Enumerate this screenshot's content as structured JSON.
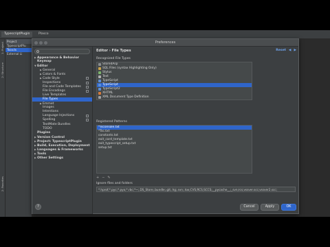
{
  "ide": {
    "project_tab": "TypescriptPlugin",
    "file_tab": "Plasco",
    "project_header": "Project",
    "project_rows": [
      "TypescriptPlu",
      "Tsco.ts",
      "External Li"
    ],
    "left_rail": [
      "1: Project",
      "2: Structure"
    ],
    "left_rail_bottom": "2: Favorites"
  },
  "dialog": {
    "title": "Preferences",
    "tree": [
      {
        "label": "Appearance & Behavior",
        "depth": 0,
        "bold": true,
        "arrow": "▶"
      },
      {
        "label": "Keymap",
        "depth": 0,
        "bold": true
      },
      {
        "label": "Editor",
        "depth": 0,
        "bold": true,
        "arrow": "▼"
      },
      {
        "label": "General",
        "depth": 1,
        "arrow": "▶"
      },
      {
        "label": "Colors & Fonts",
        "depth": 1,
        "arrow": "▶"
      },
      {
        "label": "Code Style",
        "depth": 1,
        "arrow": "▶",
        "proj": true
      },
      {
        "label": "Inspections",
        "depth": 1,
        "proj": true
      },
      {
        "label": "File and Code Templates",
        "depth": 1,
        "proj": true
      },
      {
        "label": "File Encodings",
        "depth": 1,
        "proj": true
      },
      {
        "label": "Live Templates",
        "depth": 1
      },
      {
        "label": "File Types",
        "depth": 1,
        "selected": true
      },
      {
        "label": "Emmet",
        "depth": 1,
        "arrow": "▶"
      },
      {
        "label": "Images",
        "depth": 1
      },
      {
        "label": "Intentions",
        "depth": 1
      },
      {
        "label": "Language Injections",
        "depth": 1,
        "proj": true
      },
      {
        "label": "Spelling",
        "depth": 1,
        "proj": true
      },
      {
        "label": "TextMate Bundles",
        "depth": 1
      },
      {
        "label": "TODO",
        "depth": 1
      },
      {
        "label": "Plugins",
        "depth": 0,
        "bold": true
      },
      {
        "label": "Version Control",
        "depth": 0,
        "bold": true,
        "arrow": "▶"
      },
      {
        "label": "Project: TypescriptPlugin",
        "depth": 0,
        "bold": true,
        "arrow": "▶"
      },
      {
        "label": "Build, Execution, Deployment",
        "depth": 0,
        "bold": true,
        "arrow": "▶"
      },
      {
        "label": "Languages & Frameworks",
        "depth": 0,
        "bold": true,
        "arrow": "▶"
      },
      {
        "label": "Tools",
        "depth": 0,
        "bold": true,
        "arrow": "▶"
      },
      {
        "label": "Other Settings",
        "depth": 0,
        "bold": true,
        "arrow": "▶"
      }
    ],
    "breadcrumb": "Editor › File Types",
    "reset_label": "Reset",
    "nav_back": "◀",
    "nav_forward": "▶",
    "recognized_label": "Recognized File Types",
    "file_types": [
      {
        "label": "StoredAsp",
        "color": "#8a8d90"
      },
      {
        "label": "SQL Files (syntax Highlighting Only)",
        "color": "#c9a24a"
      },
      {
        "label": "Stylus",
        "color": "#7cb36b"
      },
      {
        "label": "Text",
        "color": "#b0b0b0"
      },
      {
        "label": "TypeScript",
        "color": "#5d8fd6"
      },
      {
        "label": "TypeScript",
        "color": "#5d8fd6",
        "selected": true
      },
      {
        "label": "TypeScript2",
        "color": "#5d8fd6"
      },
      {
        "label": "XHTML",
        "color": "#d67a3a"
      },
      {
        "label": "XML Document Type Definition",
        "color": "#a0a0a0"
      }
    ],
    "patterns_label": "Registered Patterns",
    "patterns": [
      {
        "label": "*Tsconsole.txt",
        "selected": true
      },
      {
        "label": "*Tsc.txt"
      },
      {
        "label": "constants.txt"
      },
      {
        "label": "exit_card_template.txt"
      },
      {
        "label": "exit_typescript_setup.txt"
      },
      {
        "label": "setup.txt"
      }
    ],
    "tool_add": "+",
    "tool_remove": "−",
    "tool_edit": "✎",
    "ignore_label": "Ignore files and folders",
    "ignore_value": "*.hprof;*.pyc;*.pyo;*.rbc;*~;.DS_Store;.bundle;.git;.hg;.svn;.tox;CVS;RCS;SCCS;__pycache__;_svn;rcs;vssver.scc;vssver2.scc;",
    "help_label": "?",
    "cancel_label": "Cancel",
    "apply_label": "Apply",
    "ok_label": "OK"
  }
}
